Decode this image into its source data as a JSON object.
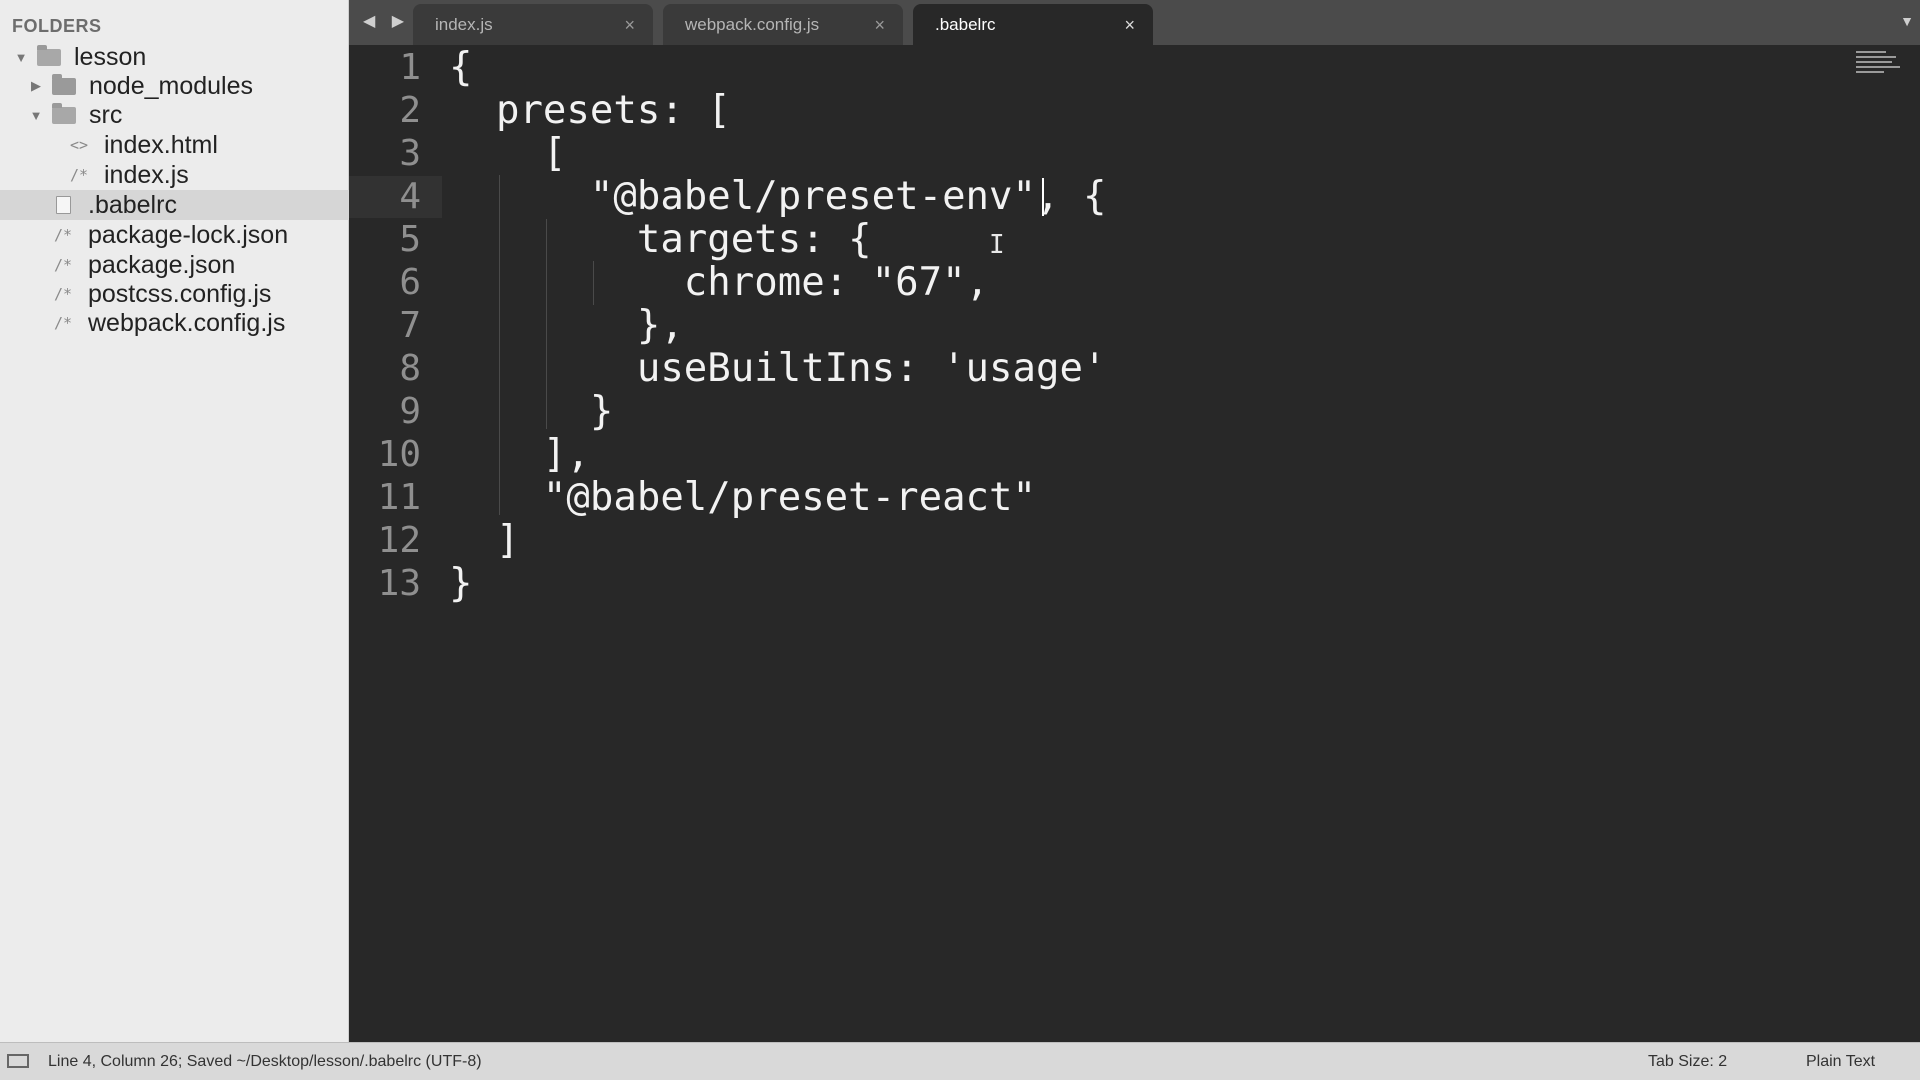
{
  "sidebar": {
    "header": "FOLDERS",
    "items": [
      {
        "label": "lesson",
        "kind": "folder-open"
      },
      {
        "label": "node_modules",
        "kind": "folder"
      },
      {
        "label": "src",
        "kind": "folder-open"
      },
      {
        "label": "index.html",
        "kind": "html",
        "icon_glyph": "<>"
      },
      {
        "label": "index.js",
        "kind": "js",
        "icon_glyph": "/*"
      },
      {
        "label": ".babelrc",
        "kind": "file"
      },
      {
        "label": "package-lock.json",
        "kind": "js",
        "icon_glyph": "/*"
      },
      {
        "label": "package.json",
        "kind": "js",
        "icon_glyph": "/*"
      },
      {
        "label": "postcss.config.js",
        "kind": "js",
        "icon_glyph": "/*"
      },
      {
        "label": "webpack.config.js",
        "kind": "js",
        "icon_glyph": "/*"
      }
    ],
    "selected": ".babelrc"
  },
  "tabs": {
    "nav_arrows": "◀ ▶",
    "items": [
      {
        "label": "index.js",
        "close": "×",
        "active": false
      },
      {
        "label": "webpack.config.js",
        "close": "×",
        "active": false
      },
      {
        "label": ".babelrc",
        "close": "×",
        "active": true
      }
    ],
    "dropdown": "▼"
  },
  "editor": {
    "line_numbers": [
      "1",
      "2",
      "3",
      "4",
      "5",
      "6",
      "7",
      "8",
      "9",
      "10",
      "11",
      "12",
      "13"
    ],
    "lines": [
      "{",
      "  presets: [",
      "    [",
      "      \"@babel/preset-env\", {",
      "        targets: {",
      "          chrome: \"67\",",
      "        },",
      "        useBuiltIns: 'usage'",
      "      }",
      "    ],",
      "    \"@babel/preset-react\"",
      "  ]",
      "}"
    ],
    "current_line": 4,
    "mouse_cursor": "I"
  },
  "statusbar": {
    "position_text": "Line 4, Column 26; Saved ~/Desktop/lesson/.babelrc (UTF-8)",
    "tab_size": "Tab Size: 2",
    "syntax": "Plain Text"
  }
}
